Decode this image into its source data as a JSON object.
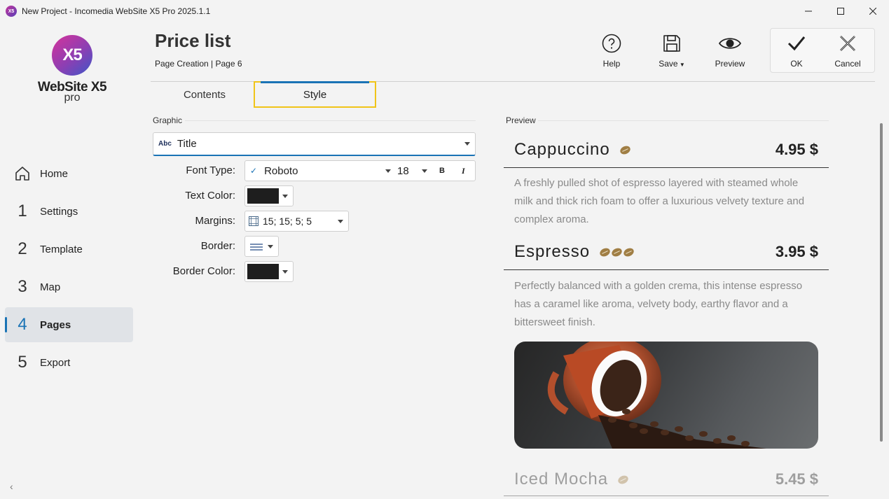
{
  "window": {
    "title": "New Project - Incomedia WebSite X5 Pro 2025.1.1",
    "icon_text": "X5"
  },
  "logo": {
    "mark": "X5",
    "name": "WebSite X5",
    "edition": "pro"
  },
  "sidebar": {
    "items": [
      {
        "num": "",
        "label": "Home",
        "icon": "home-icon"
      },
      {
        "num": "1",
        "label": "Settings"
      },
      {
        "num": "2",
        "label": "Template"
      },
      {
        "num": "3",
        "label": "Map"
      },
      {
        "num": "4",
        "label": "Pages",
        "active": true
      },
      {
        "num": "5",
        "label": "Export"
      }
    ],
    "collapse": "‹"
  },
  "header": {
    "title": "Price list",
    "breadcrumb": "Page Creation | Page 6"
  },
  "toolbar": {
    "help": "Help",
    "save": "Save",
    "preview": "Preview",
    "ok": "OK",
    "cancel": "Cancel"
  },
  "tabs": {
    "contents": "Contents",
    "style": "Style"
  },
  "graphic": {
    "section": "Graphic",
    "element_icon": "Abc",
    "element": "Title"
  },
  "form": {
    "font_type_label": "Font Type:",
    "font_name": "Roboto",
    "font_size": "18",
    "bold": "B",
    "italic": "I",
    "text_color_label": "Text Color:",
    "text_color": "#1e1e1e",
    "margins_label": "Margins:",
    "margins": "15; 15; 5; 5",
    "border_label": "Border:",
    "border_color_label": "Border Color:",
    "border_color": "#1e1e1e"
  },
  "preview": {
    "section": "Preview",
    "items": [
      {
        "name": "Cappuccino",
        "beans": 1,
        "price": "4.95 $",
        "description": "A freshly pulled shot of espresso layered with steamed whole milk and thick rich foam to offer a luxurious velvety texture and complex aroma."
      },
      {
        "name": "Espresso",
        "beans": 3,
        "price": "3.95 $",
        "description": "Perfectly balanced with a golden crema, this intense espresso has a caramel like aroma, velvety body, earthy flavor and a bittersweet finish."
      },
      {
        "name": "Iced Mocha",
        "beans": 1,
        "price": "5.45 $"
      }
    ]
  },
  "colors": {
    "accent": "#1a73b5",
    "highlight": "#f0c419",
    "bean": "#a07e44"
  }
}
